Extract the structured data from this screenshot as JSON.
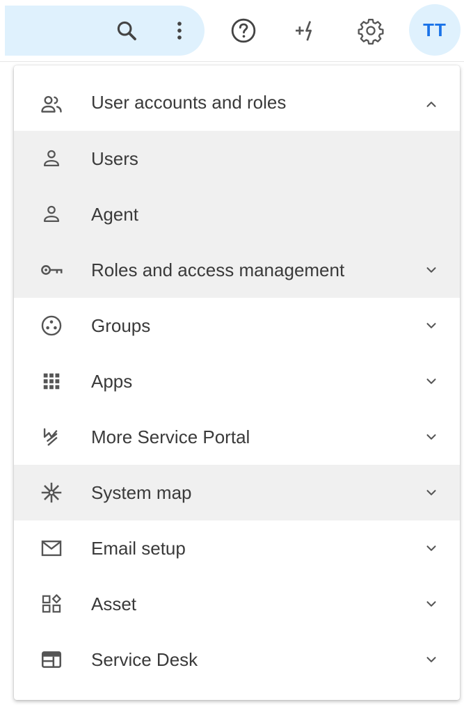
{
  "header": {
    "icons": {
      "search": "search-icon",
      "more": "more-vert-icon",
      "help": "help-circle-icon",
      "quick_add": "quick-add-icon",
      "settings": "gear-icon"
    },
    "avatar_initials": "TT"
  },
  "colors": {
    "accent": "#1a73e8",
    "pill_background": "#dff1fd",
    "highlight_row": "#f0f0f0",
    "text": "#3a3a3a"
  },
  "menu": {
    "items": [
      {
        "label": "User accounts and roles",
        "icon": "users-icon",
        "expanded": true
      },
      {
        "label": "Users",
        "icon": "user-icon"
      },
      {
        "label": "Agent",
        "icon": "user-icon"
      },
      {
        "label": "Roles and access management",
        "icon": "key-icon",
        "expanded": false
      },
      {
        "label": "Groups",
        "icon": "groups-icon",
        "expanded": false
      },
      {
        "label": "Apps",
        "icon": "apps-grid-icon",
        "expanded": false
      },
      {
        "label": "More Service Portal",
        "icon": "portal-logo-icon",
        "expanded": false
      },
      {
        "label": "System map",
        "icon": "asterisk-icon",
        "expanded": false
      },
      {
        "label": "Email setup",
        "icon": "mail-icon",
        "expanded": false
      },
      {
        "label": "Asset",
        "icon": "asset-icon",
        "expanded": false
      },
      {
        "label": "Service Desk",
        "icon": "service-desk-icon",
        "expanded": false
      }
    ]
  }
}
